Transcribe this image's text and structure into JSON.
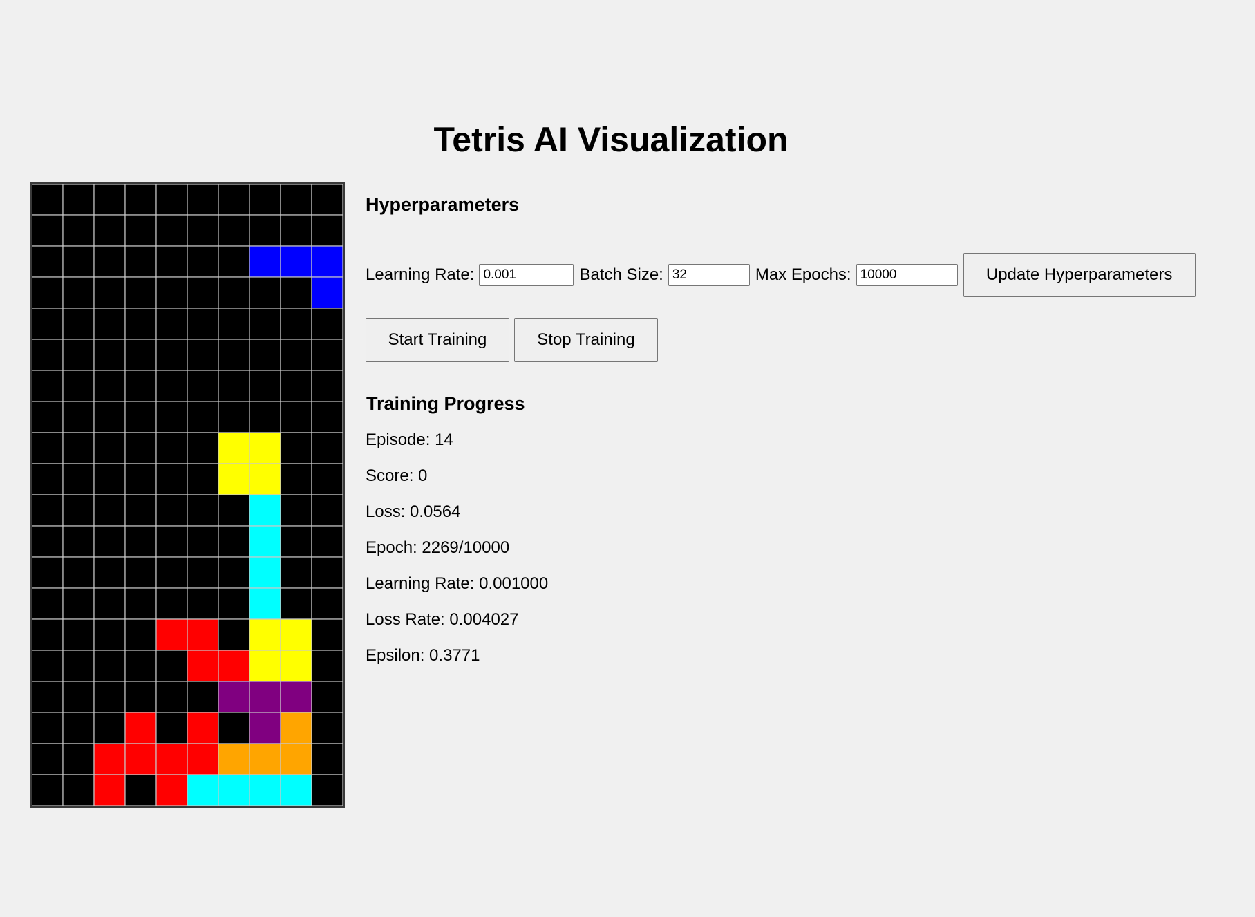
{
  "page": {
    "title": "Tetris AI Visualization"
  },
  "board": {
    "columns": 10,
    "rows": 20,
    "empty_color": "#000000",
    "grid_line_color": "#c8c8c8",
    "colors": {
      "B": "#0000ff",
      "Y": "#ffff00",
      "C": "#00ffff",
      "R": "#ff0000",
      "P": "#800080",
      "O": "#ffa500"
    },
    "cells": [
      "..........",
      "..........",
      ".......BBB",
      ".........B",
      "..........",
      "..........",
      "..........",
      "..........",
      "......YY..",
      "......YY..",
      ".......C..",
      ".......C..",
      ".......C..",
      ".......C..",
      "....RR.YY.",
      ".....RRYY.",
      "......PPP.",
      "...R.R.PO.",
      "..RRRROOO.",
      "..R.RCCCC."
    ]
  },
  "hyperparameters": {
    "heading": "Hyperparameters",
    "learning_rate": {
      "label": "Learning Rate:",
      "value": "0.001"
    },
    "batch_size": {
      "label": "Batch Size:",
      "value": "32"
    },
    "max_epochs": {
      "label": "Max Epochs:",
      "value": "10000"
    },
    "update_label": "Update Hyperparameters"
  },
  "controls": {
    "start_label": "Start Training",
    "stop_label": "Stop Training"
  },
  "progress": {
    "heading": "Training Progress",
    "episode": "Episode: 14",
    "score": "Score: 0",
    "loss": "Loss: 0.0564",
    "epoch": "Epoch: 2269/10000",
    "learning_rate": "Learning Rate: 0.001000",
    "loss_rate": "Loss Rate: 0.004027",
    "epsilon": "Epsilon: 0.3771"
  }
}
